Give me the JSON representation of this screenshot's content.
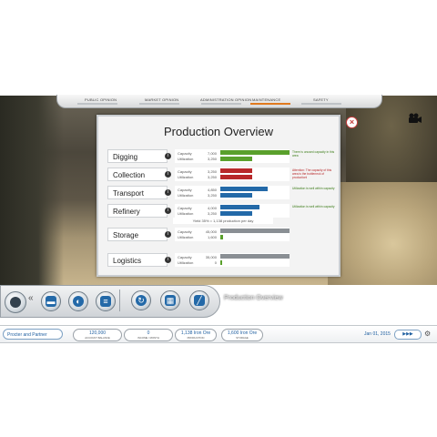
{
  "top_tabs": [
    {
      "label": "PUBLIC OPINION",
      "active": false
    },
    {
      "label": "MARKET OPINION",
      "active": false
    },
    {
      "label": "ADMINISTRATION OPINION",
      "active": false
    },
    {
      "label": "MAINTENANCE",
      "active": true
    },
    {
      "label": "SAFETY",
      "active": false
    }
  ],
  "overview": {
    "title": "Production Overview",
    "yield_text": "Yield 35% = 1,138 production per day",
    "rows": [
      {
        "name": "Digging",
        "capacity_label": "Capacity",
        "capacity": "7,000",
        "utilization_label": "Utilization",
        "utilization": "3,250",
        "capacity_frac": 1.0,
        "utilization_frac": 0.46,
        "capacity_color": "#5aa02c",
        "utilization_color": "#5aa02c",
        "note": "There is unused capacity in this area",
        "note_color": "#3d7d1a"
      },
      {
        "name": "Collection",
        "capacity_label": "Capacity",
        "capacity": "3,250",
        "utilization_label": "Utilization",
        "utilization": "3,250",
        "capacity_frac": 0.46,
        "utilization_frac": 0.46,
        "capacity_color": "#b8282a",
        "utilization_color": "#b8282a",
        "note": "Attention: The capacity of this area is the bottleneck of production!",
        "note_color": "#b8282a"
      },
      {
        "name": "Transport",
        "capacity_label": "Capacity",
        "capacity": "4,850",
        "utilization_label": "Utilization",
        "utilization": "3,250",
        "capacity_frac": 0.69,
        "utilization_frac": 0.46,
        "capacity_color": "#2369a8",
        "utilization_color": "#2369a8",
        "note": "Utilization is well within capacity",
        "note_color": "#3d7d1a"
      },
      {
        "name": "Refinery",
        "capacity_label": "Capacity",
        "capacity": "4,000",
        "utilization_label": "Utilization",
        "utilization": "3,250",
        "capacity_frac": 0.57,
        "utilization_frac": 0.46,
        "capacity_color": "#2369a8",
        "utilization_color": "#2369a8",
        "note": "Utilization is well within capacity",
        "note_color": "#3d7d1a"
      },
      {
        "name": "Storage",
        "capacity_label": "Capacity",
        "capacity": "45,000",
        "utilization_label": "Utilization",
        "utilization": "1,600",
        "capacity_frac": 1.0,
        "utilization_frac": 0.04,
        "capacity_color": "#8a8f94",
        "utilization_color": "#5aa02c",
        "note": "",
        "note_color": "#3d7d1a"
      },
      {
        "name": "Logistics",
        "capacity_label": "Capacity",
        "capacity": "35,000",
        "utilization_label": "Utilization",
        "utilization": "0",
        "capacity_frac": 1.0,
        "utilization_frac": 0.03,
        "capacity_color": "#8a8f94",
        "utilization_color": "#5aa02c",
        "note": "",
        "note_color": "#3d7d1a"
      }
    ]
  },
  "toolbar": {
    "double_arrow": "«",
    "panel_title": "Production Overview"
  },
  "status": {
    "company": "Procter and Partner",
    "stats": [
      {
        "value": "120,000",
        "label": "ACCOUNT BALANCE"
      },
      {
        "value": "0",
        "label": "INCOME / MONTH"
      },
      {
        "value": "1,138 Iron Ore",
        "label": "PRODUCTION"
      },
      {
        "value": "1,600 Iron Ore",
        "label": "STORAGE"
      }
    ],
    "date": "Jan 01, 2015"
  }
}
